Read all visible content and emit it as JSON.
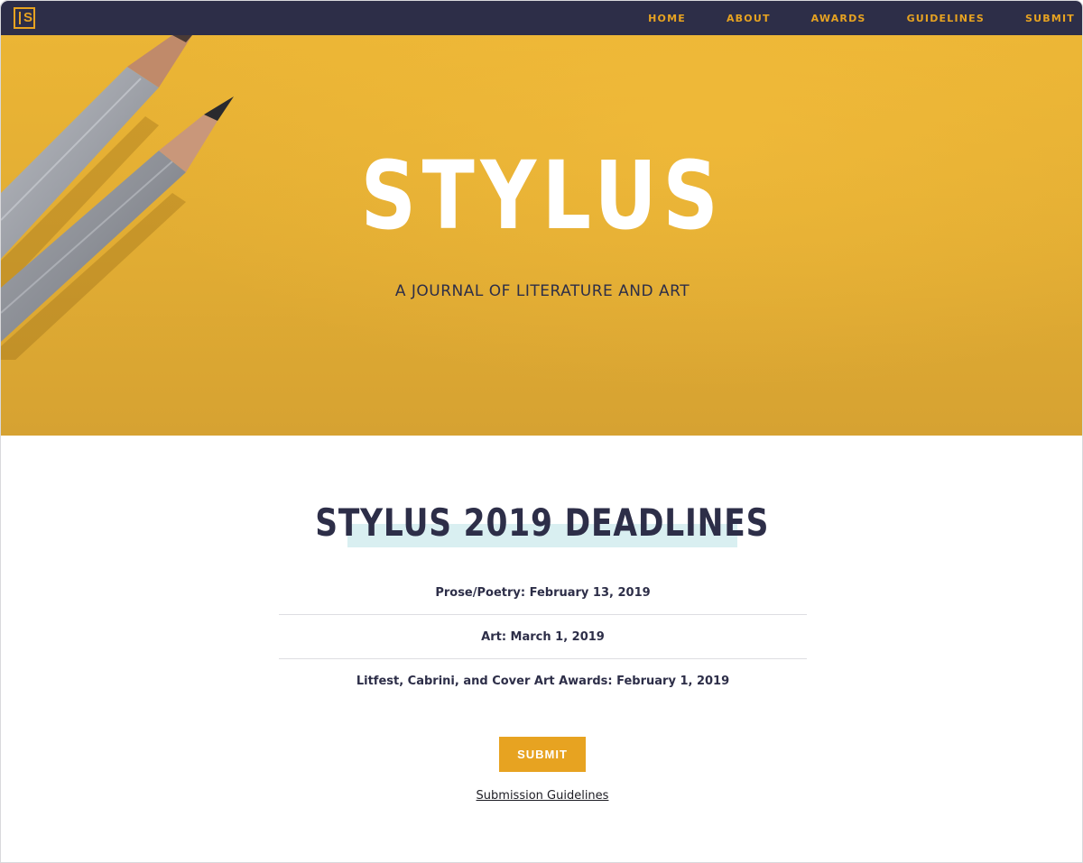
{
  "nav": {
    "logo_letter": "S",
    "links": [
      "HOME",
      "ABOUT",
      "AWARDS",
      "GUIDELINES",
      "SUBMIT"
    ]
  },
  "hero": {
    "title": "STYLUS",
    "subtitle": "A JOURNAL OF LITERATURE AND ART"
  },
  "deadlines": {
    "title": "STYLUS 2019 DEADLINES",
    "items": [
      "Prose/Poetry: February 13, 2019",
      "Art: March 1, 2019",
      "Litfest, Cabrini, and Cover Art Awards: February 1, 2019"
    ],
    "submit_label": "SUBMIT",
    "guidelines_link": "Submission Guidelines"
  },
  "colors": {
    "navy": "#2d2e48",
    "gold": "#e7a321",
    "hero_yellow": "#e6b034",
    "highlight": "#d9eff1"
  },
  "icons": {
    "logo": "stylus-logo-icon",
    "pencils": "pencils-image"
  }
}
